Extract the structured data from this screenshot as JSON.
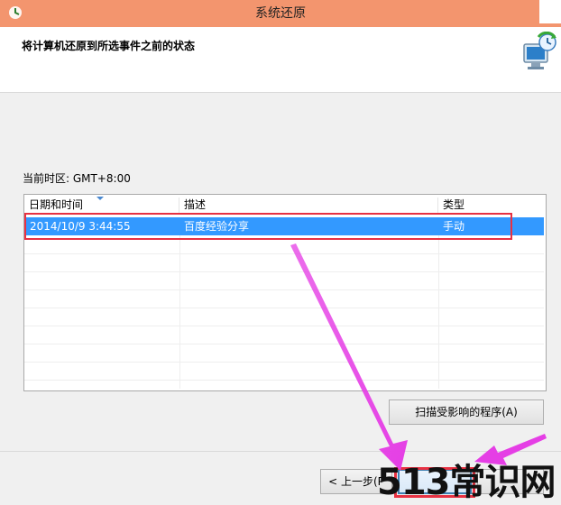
{
  "window": {
    "title": "系统还原"
  },
  "header": {
    "heading": "将计算机还原到所选事件之前的状态"
  },
  "timezone": "当前时区: GMT+8:00",
  "table": {
    "columns": [
      "日期和时间",
      "描述",
      "类型"
    ],
    "rows": [
      {
        "datetime": "2014/10/9 3:44:55",
        "description": "百度经验分享",
        "type": "手动",
        "selected": true
      }
    ]
  },
  "buttons": {
    "scan": "扫描受影响的程序(A)",
    "prev": "< 上一步(P"
  },
  "watermark": "513常识网",
  "colors": {
    "titlebar": "#f3956e",
    "selection": "#3399ff",
    "highlight": "#e83142",
    "arrow": "#e53ee5"
  }
}
